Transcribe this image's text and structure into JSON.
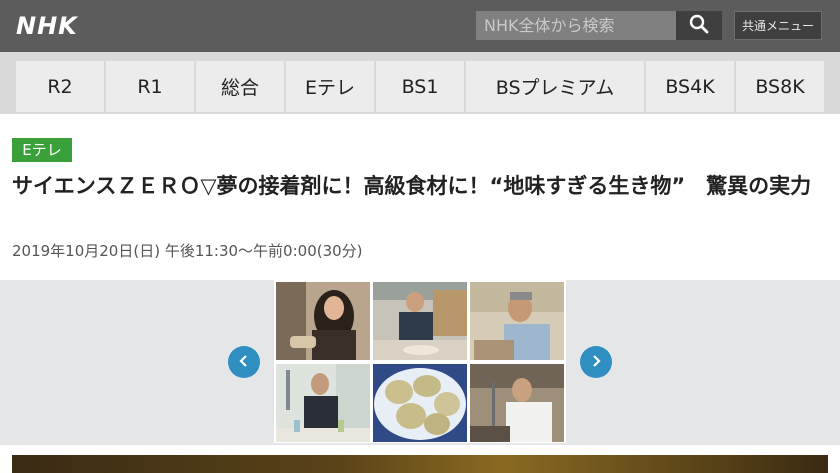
{
  "header": {
    "logo": "NHK",
    "search_placeholder": "NHK全体から検索",
    "menu_label": "共通メニュー",
    "search_icon": "search-icon"
  },
  "nav": {
    "items": [
      "R2",
      "R1",
      "総合",
      "Eテレ",
      "BS1",
      "BSプレミアム",
      "BS4K",
      "BS8K"
    ]
  },
  "program": {
    "channel_badge": "Eテレ",
    "channel_color": "#3aa03a",
    "title": "サイエンスＺＥＲＯ▽夢の接着剤に！高級食材に！“地味すぎる生き物”　驚異の実力",
    "airtime": "2019年10月20日(日) 午後11:30〜午前0:00(30分)"
  },
  "carousel": {
    "prev_icon": "chevron-left-icon",
    "next_icon": "chevron-right-icon",
    "arrow_color": "#2f8fc1",
    "thumbnails": [
      "researcher-woman",
      "cook-at-counter",
      "man-with-glasses",
      "scientist-with-pipette",
      "dumplings-on-plate",
      "man-in-lab"
    ]
  }
}
